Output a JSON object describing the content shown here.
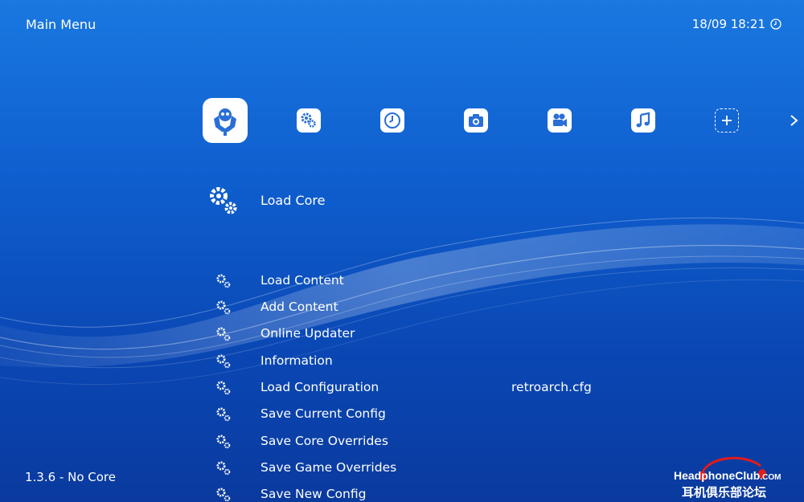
{
  "header": {
    "title": "Main Menu",
    "clock": "18/09 18:21"
  },
  "tabs": [
    {
      "name": "main-menu",
      "icon": "retroarch-invader-icon",
      "active": true
    },
    {
      "name": "settings",
      "icon": "settings-gear-icon",
      "active": false
    },
    {
      "name": "history",
      "icon": "history-clock-icon",
      "active": false
    },
    {
      "name": "images",
      "icon": "camera-icon",
      "active": false
    },
    {
      "name": "video",
      "icon": "movie-camera-icon",
      "active": false
    },
    {
      "name": "music",
      "icon": "music-note-icon",
      "active": false
    },
    {
      "name": "add",
      "icon": "add-plus-icon",
      "active": false
    }
  ],
  "selected": {
    "label": "Load Core"
  },
  "menu": [
    {
      "label": "Load Content",
      "value": ""
    },
    {
      "label": "Add Content",
      "value": ""
    },
    {
      "label": "Online Updater",
      "value": ""
    },
    {
      "label": "Information",
      "value": ""
    },
    {
      "label": "Load Configuration",
      "value": "retroarch.cfg"
    },
    {
      "label": "Save Current Config",
      "value": ""
    },
    {
      "label": "Save Core Overrides",
      "value": ""
    },
    {
      "label": "Save Game Overrides",
      "value": ""
    },
    {
      "label": "Save New Config",
      "value": ""
    }
  ],
  "footer": {
    "version": "1.3.6 - No Core"
  },
  "watermark": {
    "text": "HeadphoneClub",
    "suffix": ".COM",
    "cn": "耳机俱乐部论坛"
  },
  "colors": {
    "accent": "#ffffff",
    "background_top": "#1a78e0",
    "background_bottom": "#0a3a9e",
    "icon_fill": "#2a6fd6",
    "watermark_red": "#e21b1b"
  }
}
